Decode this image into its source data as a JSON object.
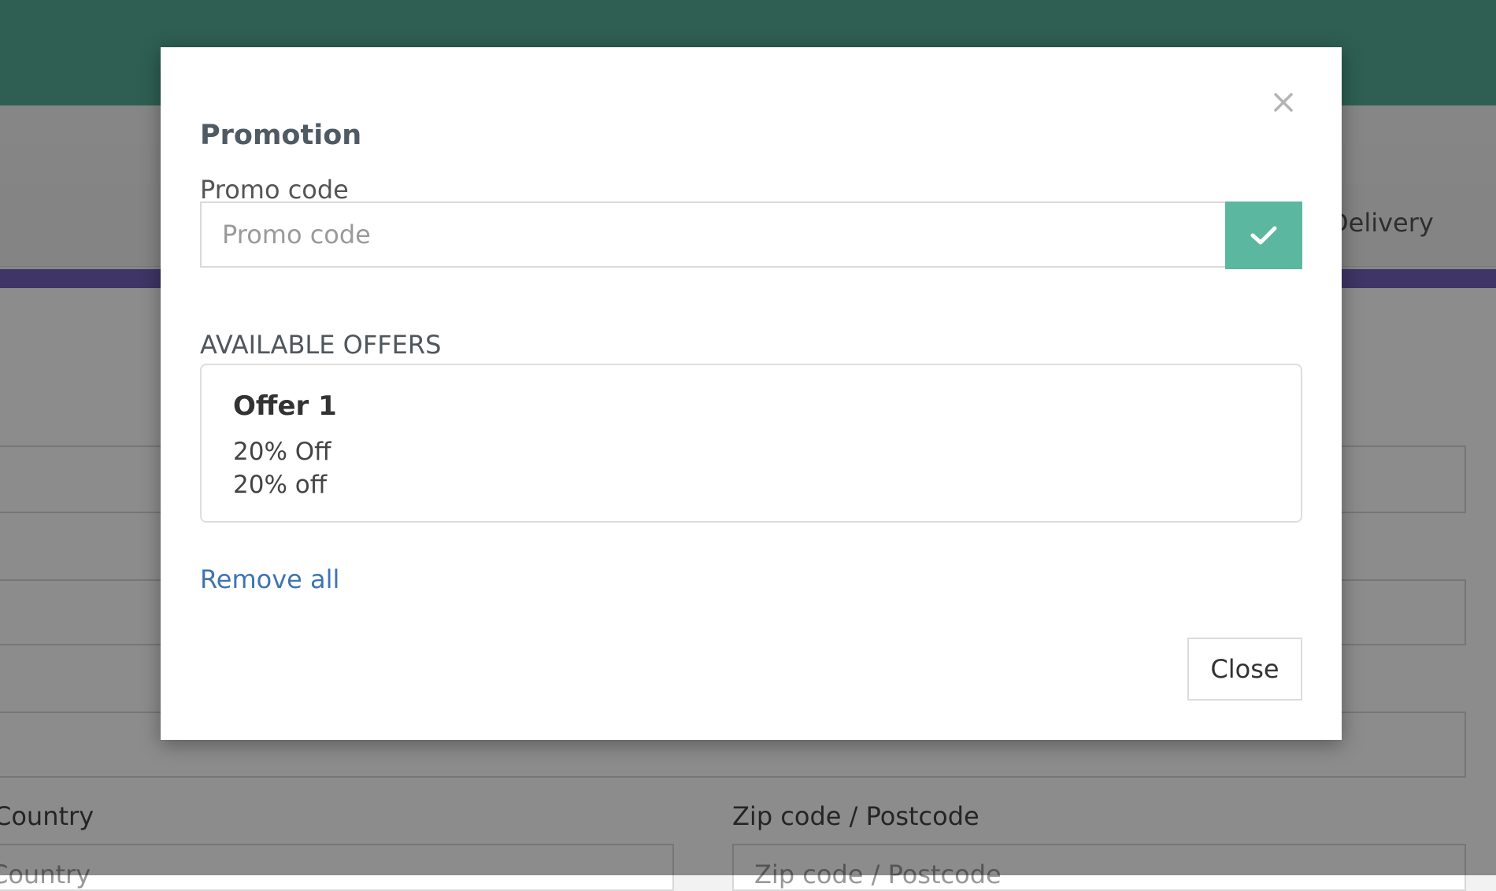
{
  "background": {
    "step_label": "Delivery",
    "country_label": "Country",
    "country_placeholder": "Country",
    "zip_label": "Zip code / Postcode",
    "zip_placeholder": "Zip code / Postcode"
  },
  "modal": {
    "title": "Promotion",
    "close_icon": "close-icon",
    "promo": {
      "label": "Promo code",
      "placeholder": "Promo code",
      "value": "",
      "apply_icon": "checkmark-icon"
    },
    "offers_heading": "AVAILABLE OFFERS",
    "offers": [
      {
        "name": "Offer 1",
        "line1": "20% Off",
        "line2": "20% off"
      }
    ],
    "remove_all_label": "Remove all",
    "close_button_label": "Close"
  },
  "colors": {
    "header": "#54ad96",
    "apply_button": "#5bb79f",
    "progress_bar": "#7362ba",
    "link": "#3e74b3"
  }
}
